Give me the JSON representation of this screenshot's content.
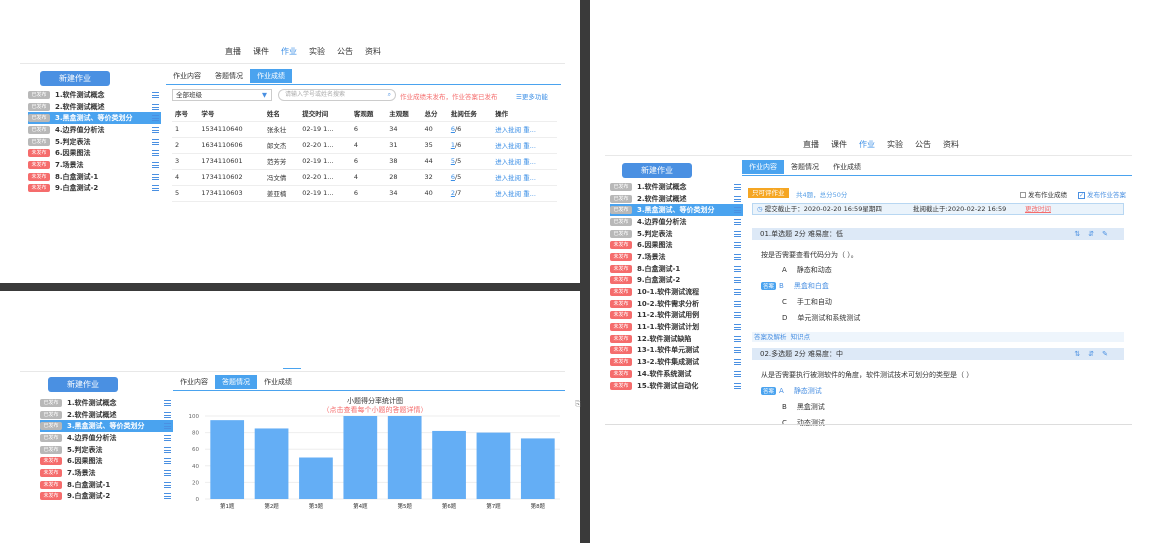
{
  "panel1": {
    "nav": [
      "直播",
      "课件",
      "作业",
      "实验",
      "公告",
      "资料"
    ],
    "new_btn": "新建作业",
    "sidebar": [
      {
        "tag": "已发布",
        "label": "1.软件测试概念",
        "pub": true
      },
      {
        "tag": "已发布",
        "label": "2.软件测试概述",
        "pub": true
      },
      {
        "tag": "已发布",
        "label": "3.黑盒测试、等价类划分",
        "pub": true,
        "sel": true
      },
      {
        "tag": "已发布",
        "label": "4.边界值分析法",
        "pub": true
      },
      {
        "tag": "已发布",
        "label": "5.判定表法",
        "pub": true
      },
      {
        "tag": "未发布",
        "label": "6.因果图法",
        "pub": false
      },
      {
        "tag": "未发布",
        "label": "7.场景法",
        "pub": false
      },
      {
        "tag": "未发布",
        "label": "8.白盒测试-1",
        "pub": false
      },
      {
        "tag": "未发布",
        "label": "9.白盒测试-2",
        "pub": false
      }
    ],
    "tabs": [
      "作业内容",
      "答题情况",
      "作业成绩"
    ],
    "select": "全部班级",
    "search_placeholder": "请输入学号或姓名搜索",
    "warn": "作业成绩未发布，作业答案已发布",
    "more": "更多功能",
    "headers": [
      "序号",
      "学号",
      "姓名",
      "提交时间",
      "客观题",
      "主观题",
      "总分",
      "批阅任务",
      "操作"
    ],
    "rows": [
      [
        "1",
        "1534110640",
        "张永壮",
        "02-19 1...",
        "6",
        "34",
        "40",
        "6/6"
      ],
      [
        "2",
        "1634110606",
        "郎文杰",
        "02-20 1...",
        "4",
        "31",
        "35",
        "1/6"
      ],
      [
        "3",
        "1734110601",
        "范芳芳",
        "02-19 1...",
        "6",
        "38",
        "44",
        "5/5"
      ],
      [
        "4",
        "1734110602",
        "冯文倩",
        "02-20 1...",
        "4",
        "28",
        "32",
        "6/5"
      ],
      [
        "5",
        "1734110603",
        "姜亚楠",
        "02-19 1...",
        "6",
        "34",
        "40",
        "2/7"
      ]
    ],
    "ops": [
      "进入批阅",
      "重..."
    ]
  },
  "panel2": {
    "new_btn": "新建作业",
    "sidebar": [
      {
        "tag": "已发布",
        "label": "1.软件测试概念",
        "pub": true
      },
      {
        "tag": "已发布",
        "label": "2.软件测试概述",
        "pub": true
      },
      {
        "tag": "已发布",
        "label": "3.黑盒测试、等价类划分",
        "pub": true,
        "sel": true
      },
      {
        "tag": "已发布",
        "label": "4.边界值分析法",
        "pub": true
      },
      {
        "tag": "已发布",
        "label": "5.判定表法",
        "pub": true
      },
      {
        "tag": "未发布",
        "label": "6.因果图法",
        "pub": false
      },
      {
        "tag": "未发布",
        "label": "7.场景法",
        "pub": false
      },
      {
        "tag": "未发布",
        "label": "8.白盒测试-1",
        "pub": false
      },
      {
        "tag": "未发布",
        "label": "9.白盒测试-2",
        "pub": false
      }
    ],
    "tabs": [
      "作业内容",
      "答题情况",
      "作业成绩"
    ],
    "chart_data": {
      "type": "bar",
      "title": "小题得分率统计图",
      "subtitle": "（点击查看每个小题的答题详情）",
      "categories": [
        "第1题",
        "第2题",
        "第3题",
        "第4题",
        "第5题",
        "第6题",
        "第7题",
        "第8题"
      ],
      "values": [
        95,
        85,
        50,
        100,
        100,
        82,
        80,
        73
      ],
      "ylim": [
        0,
        100
      ],
      "yticks": [
        "100",
        "80",
        "60",
        "40",
        "20",
        "0"
      ],
      "color": "#64aef5"
    }
  },
  "panel3": {
    "nav": [
      "直播",
      "课件",
      "作业",
      "实验",
      "公告",
      "资料"
    ],
    "new_btn": "新建作业",
    "sidebar": [
      {
        "tag": "已发布",
        "label": "1.软件测试概念",
        "pub": true
      },
      {
        "tag": "已发布",
        "label": "2.软件测试概述",
        "pub": true
      },
      {
        "tag": "已发布",
        "label": "3.黑盒测试、等价类划分",
        "pub": true,
        "sel": true
      },
      {
        "tag": "已发布",
        "label": "4.边界值分析法",
        "pub": true
      },
      {
        "tag": "已发布",
        "label": "5.判定表法",
        "pub": true
      },
      {
        "tag": "未发布",
        "label": "6.因果图法",
        "pub": false
      },
      {
        "tag": "未发布",
        "label": "7.场景法",
        "pub": false
      },
      {
        "tag": "未发布",
        "label": "8.白盒测试-1",
        "pub": false
      },
      {
        "tag": "未发布",
        "label": "9.白盒测试-2",
        "pub": false
      },
      {
        "tag": "未发布",
        "label": "10-1.软件测试流程",
        "pub": false
      },
      {
        "tag": "未发布",
        "label": "10-2.软件需求分析",
        "pub": false
      },
      {
        "tag": "未发布",
        "label": "11-2.软件测试用例",
        "pub": false
      },
      {
        "tag": "未发布",
        "label": "11-1.软件测试计划",
        "pub": false
      },
      {
        "tag": "未发布",
        "label": "12.软件测试缺陷",
        "pub": false
      },
      {
        "tag": "未发布",
        "label": "13-1.软件单元测试",
        "pub": false
      },
      {
        "tag": "未发布",
        "label": "13-2.软件集成测试",
        "pub": false
      },
      {
        "tag": "未发布",
        "label": "14.软件系统测试",
        "pub": false
      },
      {
        "tag": "未发布",
        "label": "15.软件测试自动化",
        "pub": false
      }
    ],
    "tabs": [
      "作业内容",
      "答题情况",
      "作业成绩"
    ],
    "readonly": "只可评作业",
    "summary": "共4题，总分50分",
    "pub_score": "发布作业成绩",
    "pub_answer": "发布作业答案",
    "deadline": "提交截止于：2020-02-20 16:59星期四",
    "review_deadline": "批阅截止于:2020-02-22 16:59",
    "change_time": "更改时间",
    "q1_head": "01.单选题  2分  难易度：低",
    "q1_text": "按是否需要查看代码分为（ ）。",
    "q1_opts": [
      [
        "A",
        "静态和动态"
      ],
      [
        "B",
        "黑盒和白盒"
      ],
      [
        "C",
        "手工和自动"
      ],
      [
        "D",
        "单元测试和系统测试"
      ]
    ],
    "answer_tag": "答案",
    "analysis": "答案及解析",
    "knowledge": "知识点",
    "q2_head": "02.多选题  2分  难易度：中",
    "q2_text": "从是否需要执行被测软件的角度，软件测试技术可划分的类型是（      ）",
    "q2_opts": [
      [
        "A",
        "静态测试"
      ],
      [
        "B",
        "黑盒测试"
      ],
      [
        "C",
        "动态测试"
      ]
    ]
  }
}
